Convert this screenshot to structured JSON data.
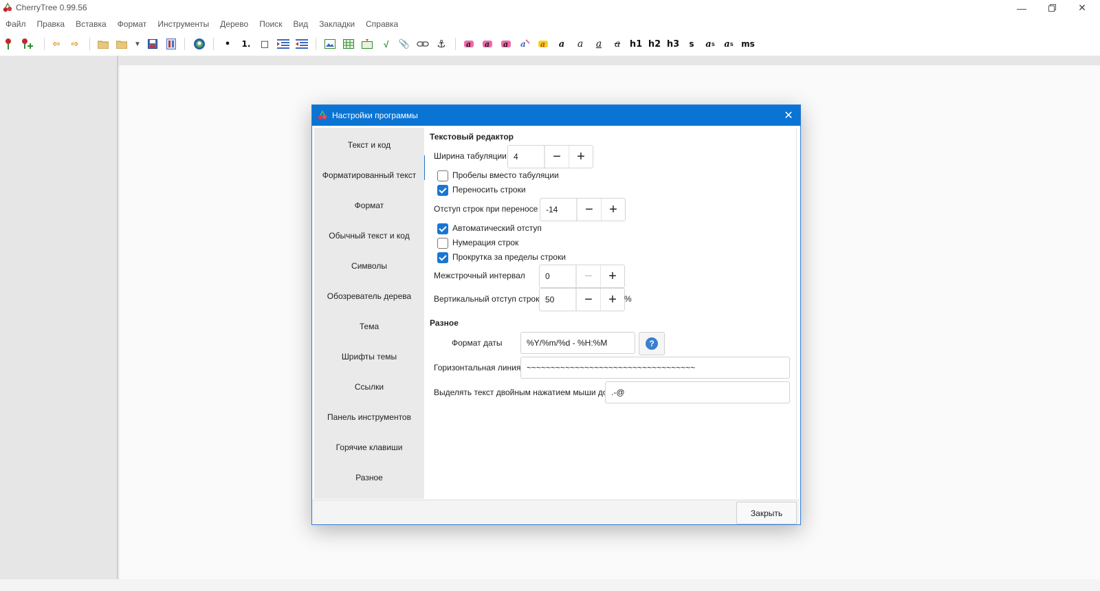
{
  "window": {
    "title": "CherryTree 0.99.56",
    "minimize_icon": "minimize-icon",
    "maximize_icon": "restore-icon",
    "close_icon": "close-icon"
  },
  "menu": [
    "Файл",
    "Правка",
    "Вставка",
    "Формат",
    "Инструменты",
    "Дерево",
    "Поиск",
    "Вид",
    "Закладки",
    "Справка"
  ],
  "toolbar": {
    "text_buttons": {
      "bold": "a",
      "italic": "a",
      "underline": "a",
      "strike": "a",
      "h1": "h1",
      "h2": "h2",
      "h3": "h3",
      "small": "s",
      "superscript_base": "a",
      "superscript_mark": "s",
      "subscript_base": "a",
      "subscript_mark": "s",
      "monospace": "ms"
    },
    "list_bullet": "•",
    "list_numbered": "1.",
    "list_todo": "□"
  },
  "dialog": {
    "title": "Настройки программы",
    "nav": [
      "Текст и код",
      "Форматированный текст",
      "Формат",
      "Обычный текст и код",
      "Символы",
      "Обозреватель дерева",
      "Тема",
      "Шрифты темы",
      "Ссылки",
      "Панель инструментов",
      "Горячие клавиши",
      "Разное"
    ],
    "selected_nav": "Текст и код",
    "text_editor": {
      "heading": "Текстовый редактор",
      "tab_width_label": "Ширина табуляции",
      "tab_width_value": "4",
      "spaces_instead_of_tabs": {
        "label": "Пробелы вместо табуляции",
        "checked": false
      },
      "wrap_lines": {
        "label": "Переносить строки",
        "checked": true
      },
      "wrap_indent_label": "Отступ строк при переносе",
      "wrap_indent_value": "-14",
      "auto_indent": {
        "label": "Автоматический отступ",
        "checked": true
      },
      "line_numbers": {
        "label": "Нумерация строк",
        "checked": false
      },
      "scroll_beyond": {
        "label": "Прокрутка за пределы строки",
        "checked": true
      },
      "line_spacing_label": "Межстрочный интервал",
      "line_spacing_value": "0",
      "vertical_indent_label": "Вертикальный отступ строк",
      "vertical_indent_value": "50",
      "vertical_indent_unit": "%"
    },
    "misc": {
      "heading": "Разное",
      "date_format_label": "Формат даты",
      "date_format_value": "%Y/%m/%d - %H:%M",
      "help_label": "?",
      "hr_label": "Горизонтальная линия",
      "hr_value": "~~~~~~~~~~~~~~~~~~~~~~~~~~~~~~~~~~~",
      "dblclick_label": "Выделять текст двойным нажатием мыши до",
      "dblclick_value": ".-@"
    },
    "close_button": "Закрыть"
  },
  "colors": {
    "accent": "#1976d2",
    "dialog_title": "#0a74d4"
  }
}
